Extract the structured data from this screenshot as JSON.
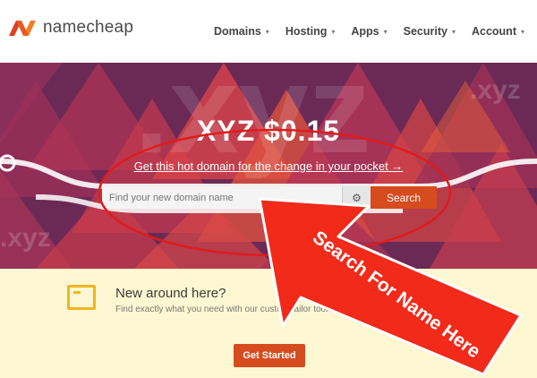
{
  "header": {
    "logo_text": "namecheap",
    "nav": [
      {
        "label": "Domains"
      },
      {
        "label": "Hosting"
      },
      {
        "label": "Apps"
      },
      {
        "label": "Security"
      },
      {
        "label": "Account"
      }
    ]
  },
  "hero": {
    "title": "XYZ $0.15",
    "subtitle": "Get this hot domain for the change in your pocket →",
    "search_placeholder": "Find your new domain name",
    "search_button": "Search"
  },
  "promo": {
    "title": "New around here?",
    "text": "Find exactly what you need with our custom tailor tool",
    "button": "Get Started"
  },
  "annotation": {
    "arrow_text": "Search For Name Here"
  },
  "colors": {
    "brand": "#d64c1e",
    "hero_bg": "#6a2a55",
    "promo_bg": "#fdf8d2",
    "annotation_red": "#e01b1b"
  }
}
